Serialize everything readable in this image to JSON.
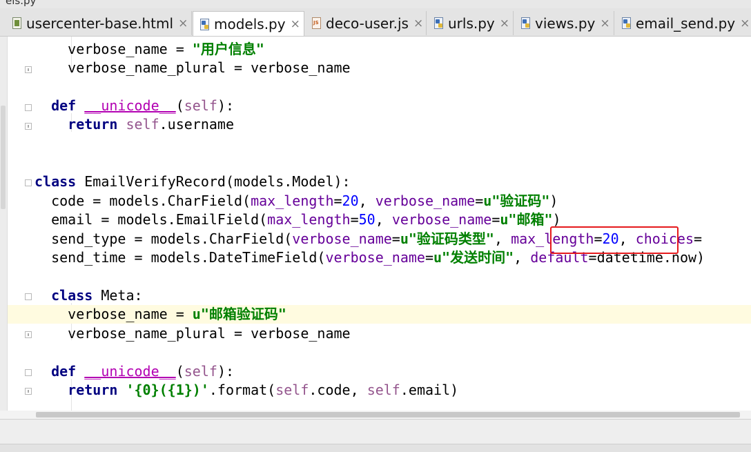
{
  "window": {
    "title_fragment": "els.py"
  },
  "tabs": [
    {
      "label": "usercenter-base.html",
      "icon": "html-file-icon",
      "active": false
    },
    {
      "label": "models.py",
      "icon": "python-file-icon",
      "active": true
    },
    {
      "label": "deco-user.js",
      "icon": "js-file-icon",
      "active": false
    },
    {
      "label": "urls.py",
      "icon": "python-file-icon",
      "active": false
    },
    {
      "label": "views.py",
      "icon": "python-file-icon",
      "active": false
    },
    {
      "label": "email_send.py",
      "icon": "python-file-icon",
      "active": false
    }
  ],
  "tab_close_glyph": "×",
  "highlight_color": "#e5191c",
  "code": {
    "l1": {
      "a": "verbose_name = ",
      "b": "\"用户信息\""
    },
    "l2": {
      "a": "verbose_name_plural = verbose_name"
    },
    "l4": {
      "kw": "def",
      "magic": "__unicode__",
      "p1": "(",
      "self": "self",
      "p2": "):"
    },
    "l5": {
      "kw": "return",
      "self": "self",
      "rest": ".username"
    },
    "l8": {
      "kw": "class",
      "rest": " EmailVerifyRecord(models.Model):"
    },
    "l9": {
      "a": "code = models.CharField(",
      "p1": "max_length",
      "eq1": "=",
      "n1": "20",
      "c1": ", ",
      "p2": "verbose_name",
      "eq2": "=",
      "s1": "u\"验证码\"",
      "end": ")"
    },
    "l10": {
      "a": "email = models.EmailField(",
      "p1": "max_length",
      "eq1": "=",
      "n1": "50",
      "c1": ", ",
      "p2": "verbose_name",
      "eq2": "=",
      "s1": "u\"邮箱\"",
      "end": ")"
    },
    "l11": {
      "a": "send_type = models.CharField(",
      "p1": "verbose_name",
      "eq1": "=",
      "s1": "u\"验证码类型\"",
      "c1": ", ",
      "p2": "max_length",
      "eq2": "=",
      "n1": "20",
      "c2": ", ",
      "p3": "choices",
      "eq3": "="
    },
    "l12": {
      "a": "send_time = models.DateTimeField(",
      "p1": "verbose_name",
      "eq1": "=",
      "s1": "u\"发送时间\"",
      "c1": ", ",
      "p2": "default",
      "eq2": "=",
      "rest": "datetime.now)"
    },
    "l14": {
      "kw": "class",
      "rest": " Meta:"
    },
    "l15": {
      "a": "verbose_name = ",
      "s1": "u\"邮箱验证码\""
    },
    "l16": {
      "a": "verbose_name_plural = verbose_name"
    },
    "l18": {
      "kw": "def",
      "magic": "__unicode__",
      "p1": "(",
      "self": "self",
      "p2": "):"
    },
    "l19": {
      "kw": "return",
      "s1": "'{0}({1})'",
      "a": ".format(",
      "self1": "self",
      "b": ".code, ",
      "self2": "self",
      "c": ".email)"
    }
  }
}
